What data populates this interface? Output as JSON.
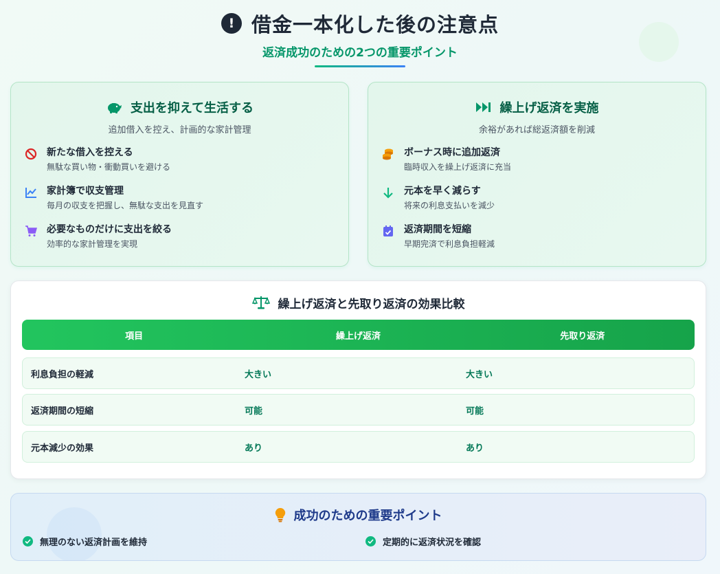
{
  "header": {
    "title": "借金一本化した後の注意点",
    "subtitle": "返済成功のための2つの重要ポイント",
    "icon": "exclamation-icon"
  },
  "cards": [
    {
      "title": "支出を抑えて生活する",
      "subtitle": "追加借入を控え、計画的な家計管理",
      "icon": "piggy-bank-icon",
      "items": [
        {
          "title": "新たな借入を控える",
          "desc": "無駄な買い物・衝動買いを避ける",
          "icon": "ban-icon",
          "color": "#dc2626"
        },
        {
          "title": "家計簿で収支管理",
          "desc": "毎月の収支を把握し、無駄な支出を見直す",
          "icon": "chart-line-icon",
          "color": "#3b82f6"
        },
        {
          "title": "必要なものだけに支出を絞る",
          "desc": "効率的な家計管理を実現",
          "icon": "cart-icon",
          "color": "#8b5cf6"
        }
      ]
    },
    {
      "title": "繰上げ返済を実施",
      "subtitle": "余裕があれば総返済額を削減",
      "icon": "fast-forward-icon",
      "items": [
        {
          "title": "ボーナス時に追加返済",
          "desc": "臨時収入を繰上げ返済に充当",
          "icon": "coins-icon",
          "color": "#f59e0b"
        },
        {
          "title": "元本を早く減らす",
          "desc": "将来の利息支払いを減少",
          "icon": "arrow-down-icon",
          "color": "#10b981"
        },
        {
          "title": "返済期間を短縮",
          "desc": "早期完済で利息負担軽減",
          "icon": "calendar-check-icon",
          "color": "#6366f1"
        }
      ]
    }
  ],
  "comparison": {
    "title": "繰上げ返済と先取り返済の効果比較",
    "icon": "scale-icon",
    "headers": [
      "項目",
      "繰上げ返済",
      "先取り返済"
    ],
    "rows": [
      [
        "利息負担の軽減",
        "大きい",
        "大きい"
      ],
      [
        "返済期間の短縮",
        "可能",
        "可能"
      ],
      [
        "元本減少の効果",
        "あり",
        "あり"
      ]
    ]
  },
  "key_points": {
    "title": "成功のための重要ポイント",
    "icon": "lightbulb-icon",
    "items": [
      "無理のない返済計画を維持",
      "定期的に返済状況を確認"
    ]
  },
  "colors": {
    "accent_green": "#059669",
    "header_green": "#22c55e",
    "dark_text": "#1f2937",
    "blue_title": "#1e3a8a"
  }
}
